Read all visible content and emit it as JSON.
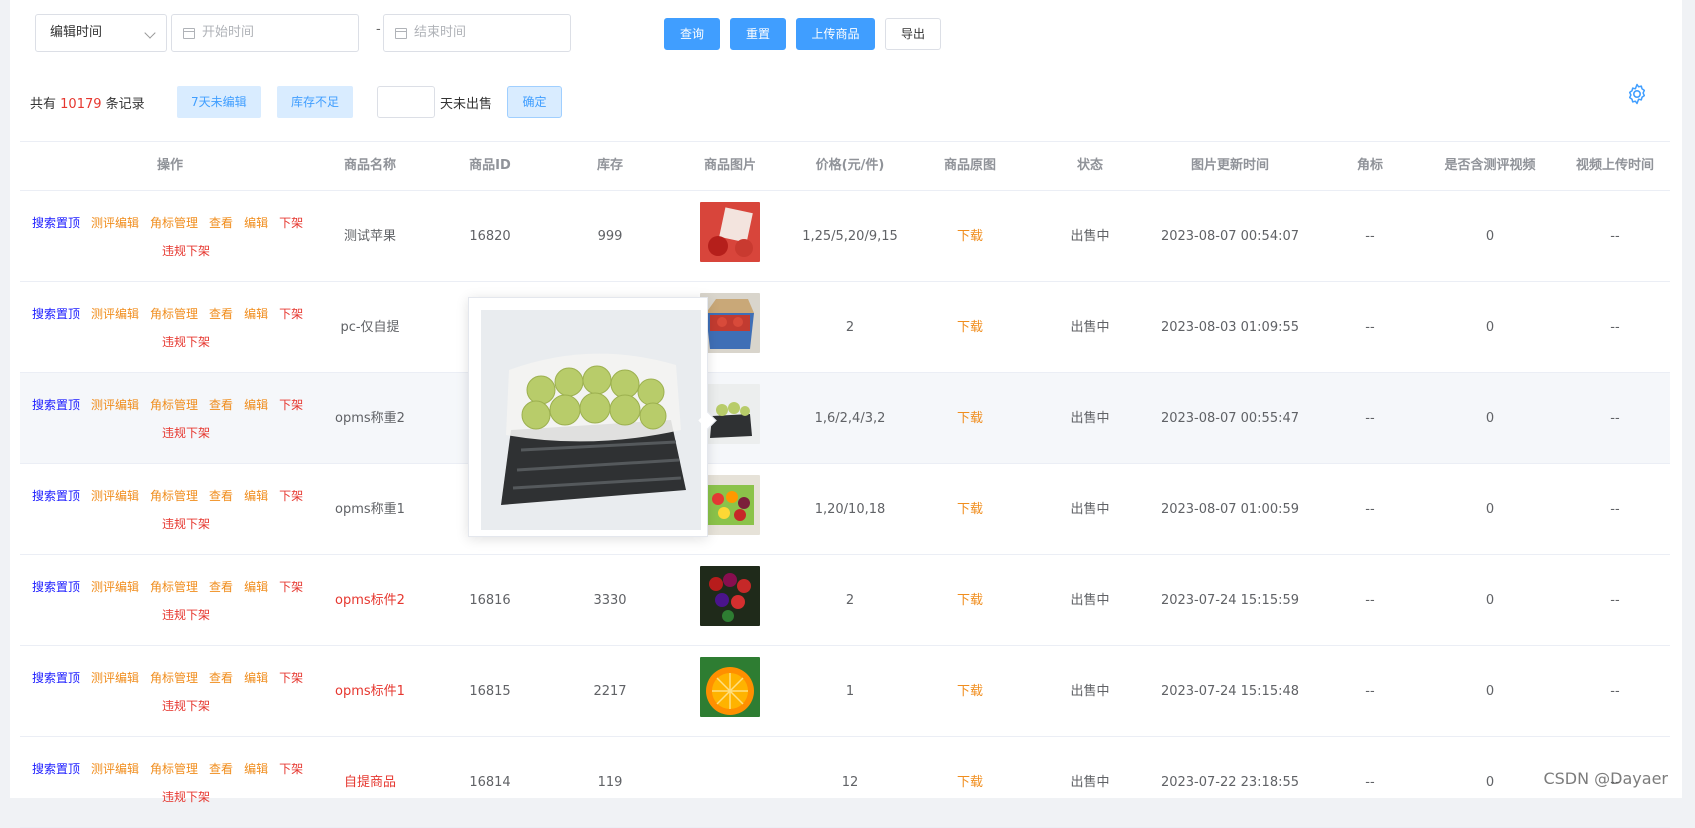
{
  "toolbar": {
    "time_select": "编辑时间",
    "start_placeholder": "开始时间",
    "end_placeholder": "结束时间",
    "separator": "-",
    "query_label": "查询",
    "reset_label": "重置",
    "upload_label": "上传商品",
    "export_label": "导出"
  },
  "filters": {
    "total_prefix": "共有",
    "total_count": "10179",
    "total_suffix": "条记录",
    "chip_unedited": "7天未编辑",
    "chip_low_stock": "库存不足",
    "days_value": "",
    "days_label": "天未出售",
    "confirm_label": "确定"
  },
  "table": {
    "columns": [
      "操作",
      "商品名称",
      "商品ID",
      "库存",
      "商品图片",
      "价格(元/件)",
      "商品原图",
      "状态",
      "图片更新时间",
      "角标",
      "是否含测评视频",
      "视频上传时间"
    ],
    "ops": {
      "search_top": "搜索置顶",
      "review_edit": "测评编辑",
      "badge_manage": "角标管理",
      "view": "查看",
      "edit": "编辑",
      "delist": "下架",
      "violation_delist": "违规下架"
    },
    "rows": [
      {
        "name": "测试苹果",
        "id": "16820",
        "stock": "999",
        "price": "1,25/5,20/9,15",
        "download": "下载",
        "status": "出售中",
        "updated": "2023-08-07 00:54:07",
        "badge": "--",
        "has_video": "0",
        "video_time": "--",
        "name_red": false,
        "highlight": false
      },
      {
        "name": "pc-仅自提",
        "id": "",
        "stock": "",
        "price": "2",
        "download": "下载",
        "status": "出售中",
        "updated": "2023-08-03 01:09:55",
        "badge": "--",
        "has_video": "0",
        "video_time": "--",
        "name_red": false,
        "highlight": false
      },
      {
        "name": "opms称重2",
        "id": "",
        "stock": "",
        "price": "1,6/2,4/3,2",
        "download": "下载",
        "status": "出售中",
        "updated": "2023-08-07 00:55:47",
        "badge": "--",
        "has_video": "0",
        "video_time": "--",
        "name_red": false,
        "highlight": true
      },
      {
        "name": "opms称重1",
        "id": "",
        "stock": "",
        "price": "1,20/10,18",
        "download": "下载",
        "status": "出售中",
        "updated": "2023-08-07 01:00:59",
        "badge": "--",
        "has_video": "0",
        "video_time": "--",
        "name_red": false,
        "highlight": false
      },
      {
        "name": "opms标件2",
        "id": "16816",
        "stock": "3330",
        "price": "2",
        "download": "下载",
        "status": "出售中",
        "updated": "2023-07-24 15:15:59",
        "badge": "--",
        "has_video": "0",
        "video_time": "--",
        "name_red": true,
        "highlight": false
      },
      {
        "name": "opms标件1",
        "id": "16815",
        "stock": "2217",
        "price": "1",
        "download": "下载",
        "status": "出售中",
        "updated": "2023-07-24 15:15:48",
        "badge": "--",
        "has_video": "0",
        "video_time": "--",
        "name_red": true,
        "highlight": false
      },
      {
        "name": "自提商品",
        "id": "16814",
        "stock": "119",
        "price": "12",
        "download": "下载",
        "status": "出售中",
        "updated": "2023-07-22 23:18:55",
        "badge": "--",
        "has_video": "0",
        "video_time": "--",
        "name_red": true,
        "highlight": false
      }
    ]
  },
  "icons": {
    "settings": "gear-icon",
    "calendar": "calendar-icon",
    "dropdown": "chevron-down-icon"
  },
  "colors": {
    "primary": "#409eff",
    "danger": "#e6372f",
    "warning": "#f08d1d",
    "link_blue": "#1a1aff"
  },
  "watermark": "CSDN @Dayaer"
}
